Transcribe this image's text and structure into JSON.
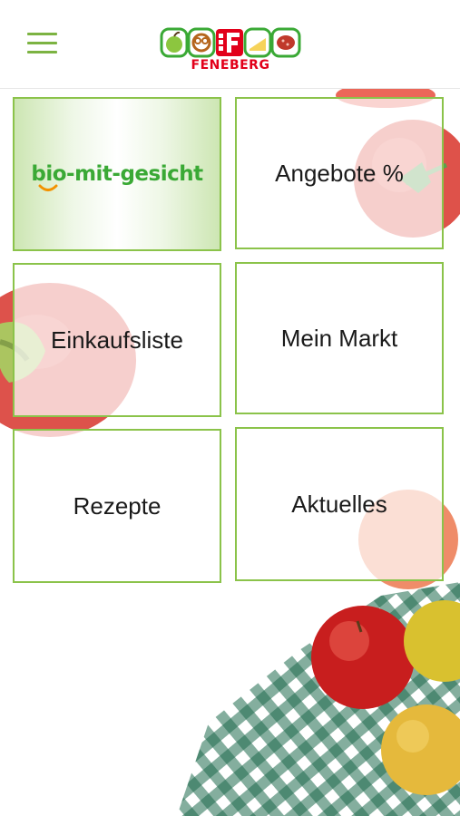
{
  "header": {
    "menu_icon": "hamburger-menu-icon",
    "logo": {
      "wordmark": "FENEBERG",
      "icons": [
        "apple-icon",
        "pretzel-icon",
        "f-brand-icon",
        "cheese-icon",
        "sausage-icon"
      ]
    }
  },
  "tiles": [
    {
      "label": "bio-mit-gesicht",
      "kind": "logo"
    },
    {
      "label": "Angebote %"
    },
    {
      "label": "Einkaufsliste"
    },
    {
      "label": "Mein Markt"
    },
    {
      "label": "Rezepte"
    },
    {
      "label": "Aktuelles"
    }
  ],
  "colors": {
    "accent_green": "#8bc34a",
    "bio_green": "#3aa935",
    "brand_red": "#e2001a",
    "tablecloth_green": "#1f6b4f"
  }
}
